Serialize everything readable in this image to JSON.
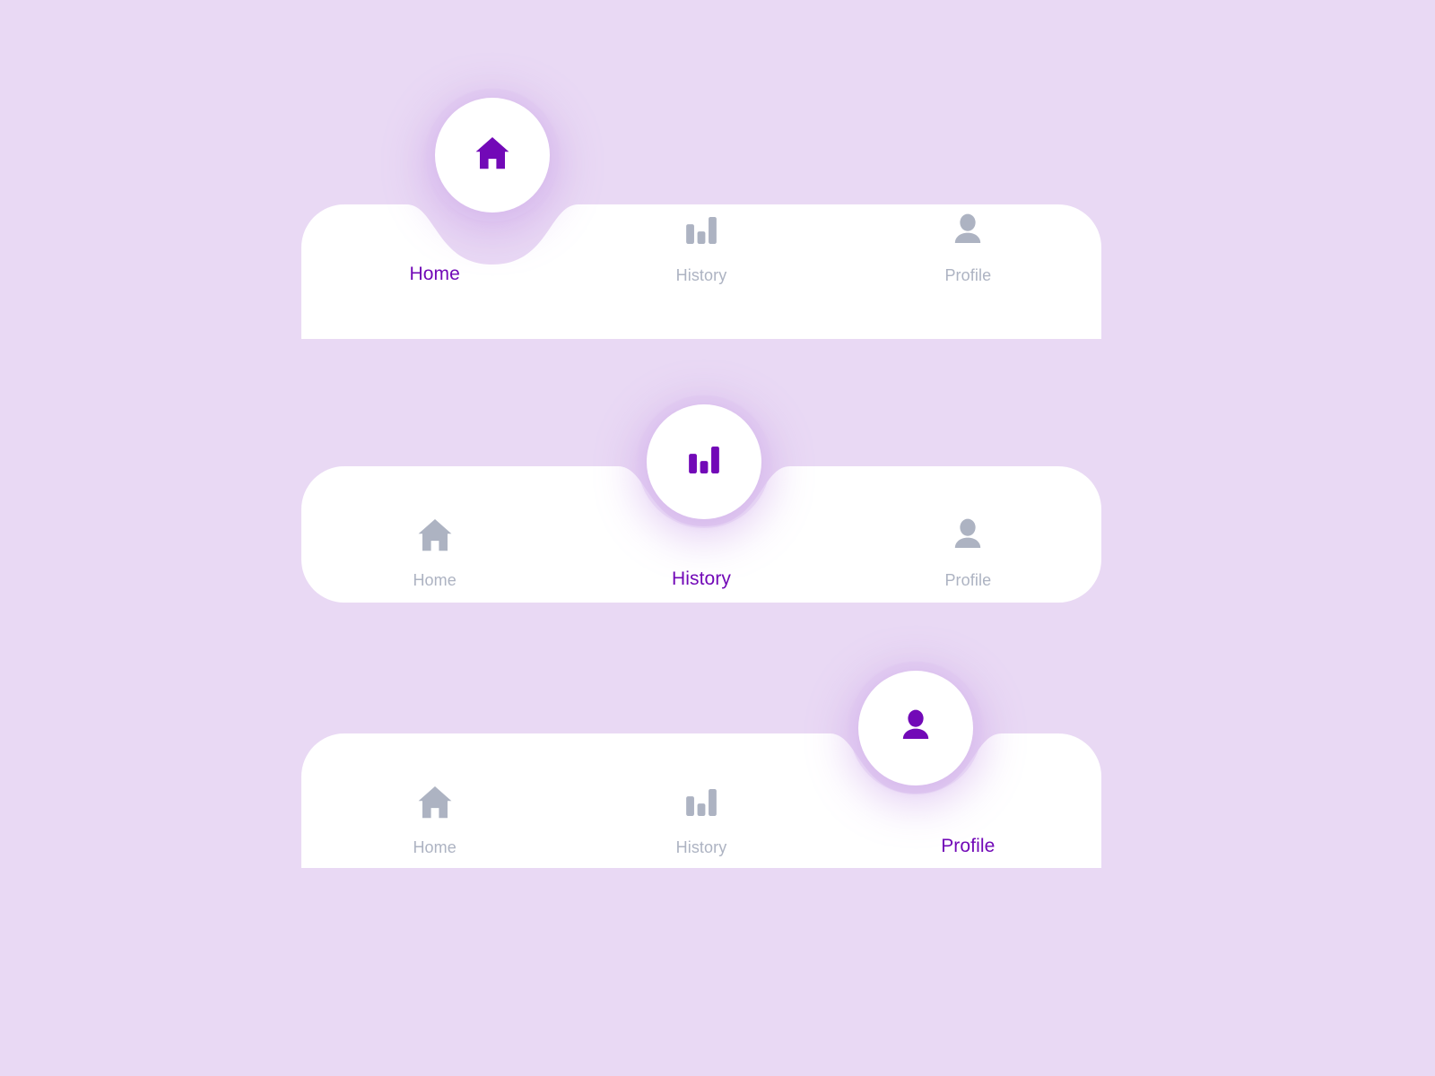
{
  "theme": {
    "background": "#e9d9f4",
    "surface": "#ffffff",
    "accent": "#7209b7",
    "inactive": "#adb3c2",
    "glow": "#dfc7f0"
  },
  "navbars": [
    {
      "id": "home",
      "active_index": 0,
      "items": [
        {
          "label": "Home",
          "icon": "home-icon"
        },
        {
          "label": "History",
          "icon": "bar-chart-icon"
        },
        {
          "label": "Profile",
          "icon": "person-icon"
        }
      ]
    },
    {
      "id": "history",
      "active_index": 1,
      "items": [
        {
          "label": "Home",
          "icon": "home-icon"
        },
        {
          "label": "History",
          "icon": "bar-chart-icon"
        },
        {
          "label": "Profile",
          "icon": "person-icon"
        }
      ]
    },
    {
      "id": "profile",
      "active_index": 2,
      "items": [
        {
          "label": "Home",
          "icon": "home-icon"
        },
        {
          "label": "History",
          "icon": "bar-chart-icon"
        },
        {
          "label": "Profile",
          "icon": "person-icon"
        }
      ]
    }
  ]
}
